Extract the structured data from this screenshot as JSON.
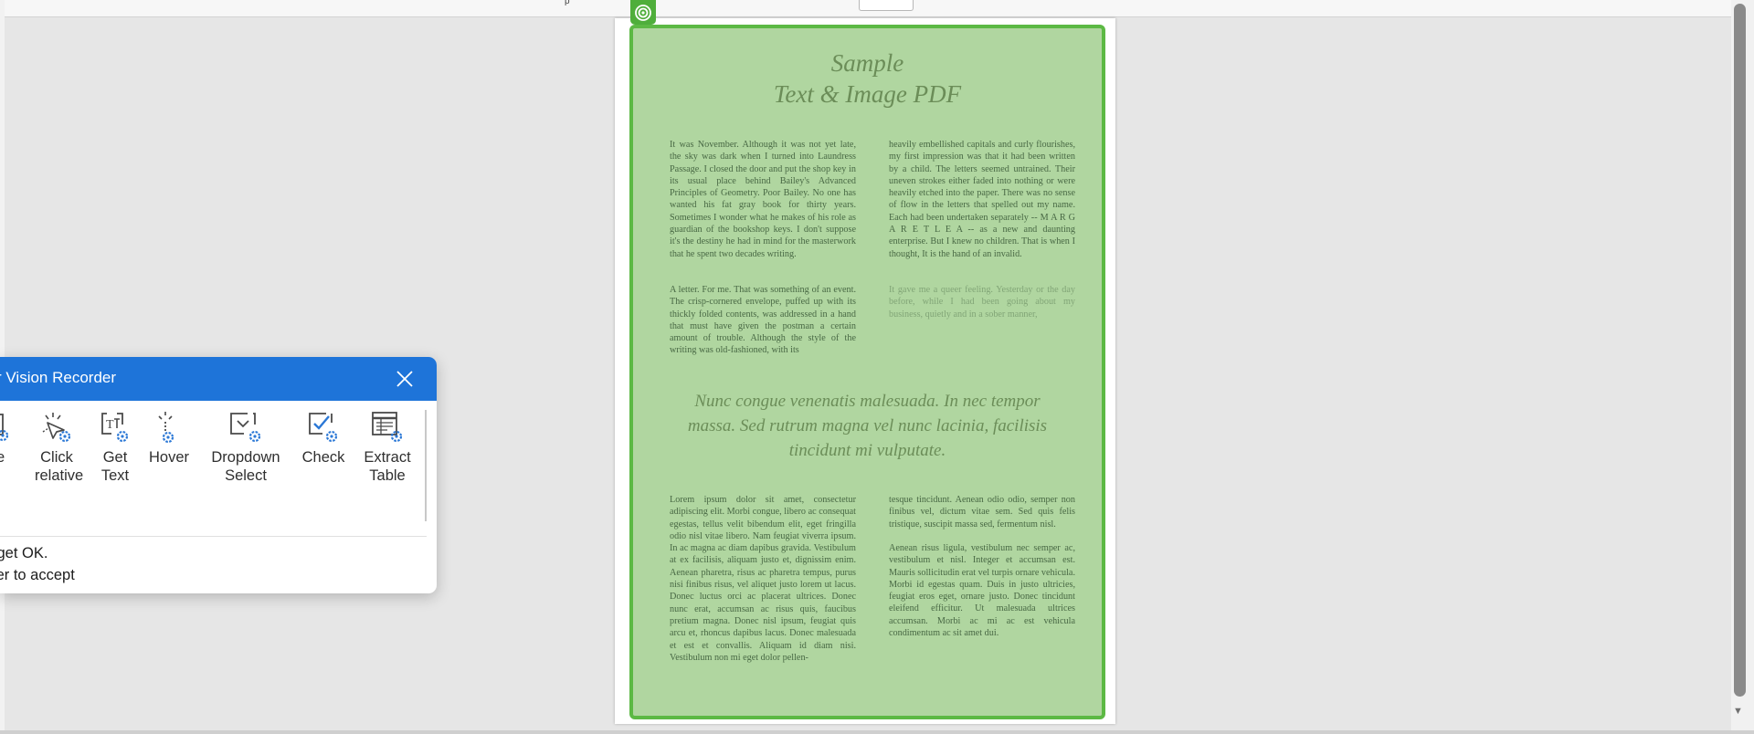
{
  "toolbar": {
    "partial_text": "p"
  },
  "document": {
    "title_line1": "Sample",
    "title_line2": "Text & Image PDF",
    "left_col_top": "It was November. Although it was not yet late, the sky was dark when I turned into Laundress Passage. I closed the door and put the shop key in its usual place behind Bailey's Advanced Principles of Geometry. Poor Bailey. No one has wanted his fat gray book for thirty years. Sometimes I wonder what he makes of his role as guardian of the bookshop keys. I don't suppose it's the destiny he had in mind for the masterwork that he spent two decades writing.",
    "left_col_top_2": "A letter. For me. That was something of an event. The crisp-cornered envelope, puffed up with its thickly folded contents, was addressed in a hand that must have given the postman a certain amount of trouble. Although the style of the writing was old-fashioned, with its",
    "right_col_top": "heavily embellished capitals and curly flourishes, my first impression was that it had been written by a child. The letters seemed untrained. Their uneven strokes either faded into nothing or were heavily etched into the paper. There was no sense of flow in the letters that spelled out my name. Each had been undertaken separately -- M A R G A R E T L E A -- as a new and daunting enterprise. But I knew no children. That is when I thought, It is the hand of an invalid.",
    "right_col_top_2": "It gave me a queer feeling. Yesterday or the day before, while I had been going about my business, quietly and in a sober manner,",
    "quote": "Nunc congue venenatis malesuada. In nec tempor massa. Sed rutrum magna vel nunc lacinia, facilisis tincidunt mi vulputate.",
    "left_col_bottom": "Lorem ipsum dolor sit amet, consectetur adipiscing elit. Morbi congue, libero ac consequat egestas, tellus velit bibendum elit, eget fringilla odio nisl vitae libero. Nam feugiat viverra ipsum. In ac magna ac diam dapibus gravida. Vestibulum at ex facilisis, aliquam justo et, dignissim enim. Aenean pharetra, risus ac pharetra tempus, purus nisi finibus risus, vel aliquet justo lorem ut lacus. Donec luctus orci ac placerat ultrices. Donec nunc erat, accumsan ac risus quis, faucibus pretium magna. Donec nisl ipsum, feugiat quis arcu et, rhoncus dapibus lacus. Donec malesuada et est et convallis. Aliquam id diam nisi. Vestibulum non mi eget dolor pellen-",
    "right_col_bottom": "tesque tincidunt. Aenean odio odio, semper non finibus vel, dictum vitae sem. Sed quis felis tristique, suscipit massa sed, fermentum nisl.",
    "right_col_bottom_2": "Aenean risus ligula, vestibulum nec semper ac, vestibulum et nisl. Integer et accumsan est. Mauris sollicitudin erat vel turpis ornare vehicula. Morbi id egestas quam. Duis in justo ultricies, feugiat eros eget, ornare justo. Donec tincidunt eleifend efficitur. Ut malesuada ultrices accumsan. Morbi ac mi ac est vehicula condimentum ac sit amet dui."
  },
  "recorder": {
    "title": "r Vision Recorder",
    "tools": [
      {
        "label1": "pe",
        "label2": "",
        "icon": "type-into-icon"
      },
      {
        "label1": "Click",
        "label2": "relative",
        "icon": "click-relative-icon"
      },
      {
        "label1": "Get",
        "label2": "Text",
        "icon": "get-text-icon"
      },
      {
        "label1": "Hover",
        "label2": "",
        "icon": "hover-icon"
      },
      {
        "label1": "Dropdown",
        "label2": "Select",
        "icon": "dropdown-select-icon"
      },
      {
        "label1": "Check",
        "label2": "",
        "icon": "check-icon"
      },
      {
        "label1": "Extract",
        "label2": "Table",
        "icon": "extract-table-icon"
      }
    ],
    "status_line1": "rget OK.",
    "status_line2": "ter to accept"
  },
  "colors": {
    "header_blue": "#1e74d9",
    "highlight_green": "#b0d6a0",
    "highlight_border": "#5cb944",
    "gear_blue": "#2b78d6"
  }
}
